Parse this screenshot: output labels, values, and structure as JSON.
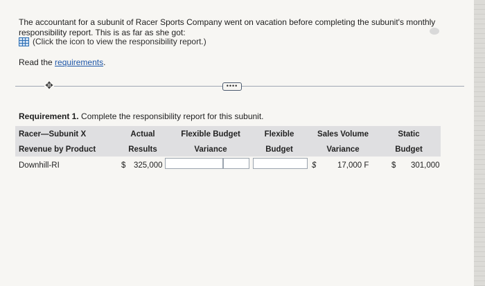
{
  "intro": "The accountant for a subunit of Racer Sports Company went on vacation before completing the subunit's monthly responsibility report. This is as far as she got:",
  "click_text": "(Click the icon to view the responsibility report.)",
  "read_prefix": "Read the",
  "read_link": "requirements",
  "read_suffix": ".",
  "more_label": "••••",
  "requirement": {
    "bold": "Requirement 1.",
    "text": " Complete the responsibility report for this subunit."
  },
  "table": {
    "headers": {
      "title1": "Racer—Subunit X",
      "title2": "Revenue by Product",
      "actual1": "Actual",
      "actual2": "Results",
      "flexvar1": "Flexible Budget",
      "flexvar2": "Variance",
      "flex1": "Flexible",
      "flex2": "Budget",
      "salesvar1": "Sales Volume",
      "salesvar2": "Variance",
      "static1": "Static",
      "static2": "Budget"
    },
    "row": {
      "label": "Downhill-RI",
      "actual_currency": "$",
      "actual_value": "325,000",
      "flex_currency": "$",
      "sales_variance": "17,000 F",
      "static_currency": "$",
      "static_value": "301,000"
    }
  },
  "colors": {
    "link": "#1d56a8",
    "header_bg": "#dfdfe1",
    "icon": "#2a6db3"
  }
}
